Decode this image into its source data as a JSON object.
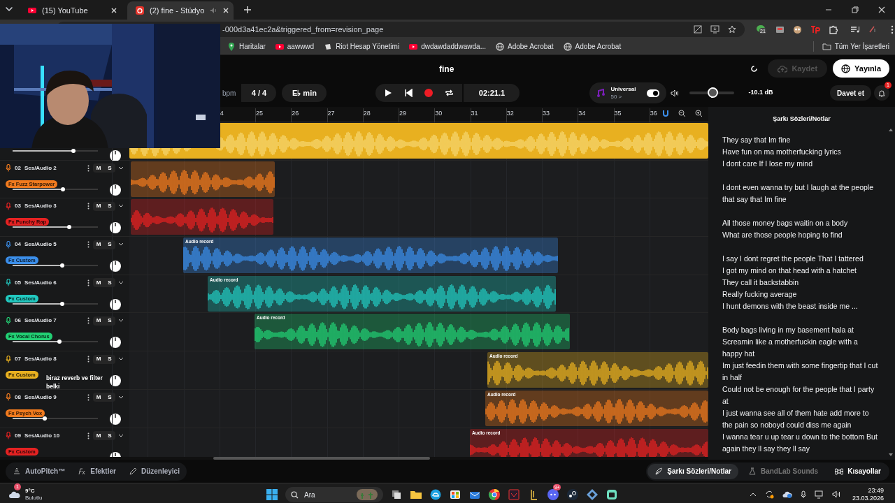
{
  "browser": {
    "tabs": [
      {
        "label": "(15) YouTube",
        "selected": false
      },
      {
        "label": "(2) fine - Stüdyo",
        "selected": true
      }
    ],
    "url": "-000d3a41ec2a&triggered_from=revision_page",
    "extension_badge": "21",
    "bookmarks": [
      "Haritalar",
      "aawwwd",
      "Riot Hesap Yönetimi",
      "dwdawdaddwawda...",
      "Adobe Acrobat",
      "Adobe Acrobat"
    ],
    "all_bookmarks": "Tüm Yer İşaretleri"
  },
  "project": {
    "title": "fine",
    "save": "Kaydet",
    "publish": "Yayınla"
  },
  "transport": {
    "bpm_label": "bpm",
    "time_signature": "4 / 4",
    "key": "E♭ min",
    "time": "02:21.1",
    "universal": {
      "label": "Universal",
      "value": "50 >",
      "on": true
    },
    "volume": {
      "level": 0.51,
      "reading": "-10.1 dB"
    },
    "invite": "Davet et",
    "notifications": "1"
  },
  "ruler": [
    "4",
    "25",
    "26",
    "27",
    "28",
    "29",
    "30",
    "31",
    "32",
    "33",
    "34",
    "35",
    "36"
  ],
  "tracks": [
    {
      "color": "#e8b020",
      "level": 0.71
    },
    {
      "number": "02",
      "name": "Ses/Audio 2",
      "fx": "Fx Fuzz Starpower",
      "color": "#f07a1e",
      "level": 0.59,
      "mute": "M",
      "solo": "S"
    },
    {
      "number": "03",
      "name": "Ses/Audio 3",
      "fx": "Fx Punchy Rap",
      "color": "#e52222",
      "level": 0.66,
      "mute": "M",
      "solo": "S"
    },
    {
      "number": "04",
      "name": "Ses/Audio 5",
      "fx": "Fx Custom",
      "color": "#3b8eea",
      "level": 0.58,
      "mute": "M",
      "solo": "S",
      "clip_label": "Audio record"
    },
    {
      "number": "05",
      "name": "Ses/Audio 6",
      "fx": "Fx Custom",
      "color": "#22c9c0",
      "level": 0.58,
      "mute": "M",
      "solo": "S",
      "clip_label": "Audio record"
    },
    {
      "number": "06",
      "name": "Ses/Audio 7",
      "fx": "Fx Vocal Chorus",
      "color": "#22d074",
      "level": 0.55,
      "mute": "M",
      "solo": "S",
      "clip_label": "Audio record"
    },
    {
      "number": "07",
      "name": "Ses/Audio 8",
      "fx": "Fx Custom",
      "color": "#e8b020",
      "note": "biraz reverb ve filter belki",
      "mute": "M",
      "solo": "S",
      "clip_label": "Audio record"
    },
    {
      "number": "08",
      "name": "Ses/Audio 9",
      "fx": "Fx Psych Vox",
      "color": "#f07a1e",
      "level": 0.38,
      "mute": "M",
      "solo": "S",
      "clip_label": "Audio record"
    },
    {
      "number": "09",
      "name": "Ses/Audio 10",
      "fx": "Fx Custom",
      "color": "#e52222",
      "mute": "M",
      "solo": "S",
      "clip_label": "Audio record"
    }
  ],
  "lyrics": {
    "title": "Şarkı Sözleri/Notlar",
    "stanzas": [
      [
        "They say that Im fine",
        "Have fun on ma motherfucking lyrics",
        "I dont care If I lose my mind"
      ],
      [
        "I dont even wanna try but I laugh at the people that say that Im fine"
      ],
      [
        "All those money bags waitin on a body",
        "What are those people hoping to find"
      ],
      [
        "I say I dont regret the people That I tattered",
        "I got my mind on that head with a hatchet",
        "They call it backstabbin",
        "Really fucking average",
        "I hunt demons with the beast inside me ..."
      ],
      [
        "Body bags living in my basement hala at",
        "Screamin like a motherfuckin eagle with a happy hat",
        "Im just feedin them with some fingertip that I cut in half",
        "Could not be enough for the people that I party at",
        "I just wanna see all of them hate add more to the pain so noboyd could diss me again",
        "I wanna tear u up tear u down to the bottom But again they ll say they ll say"
      ]
    ]
  },
  "bottom_left": [
    {
      "kind": "pitch",
      "label": "AutoPitch™"
    },
    {
      "kind": "fx",
      "label": "Efektler"
    },
    {
      "kind": "pencil",
      "label": "Düzenleyici"
    }
  ],
  "bottom_right": [
    {
      "kind": "feather",
      "label": "Şarkı Sözleri/Notlar",
      "selected": true,
      "disabled": false
    },
    {
      "kind": "flask",
      "label": "BandLab Sounds",
      "selected": false,
      "disabled": true
    },
    {
      "kind": "command",
      "label": "Kısayollar",
      "selected": false,
      "disabled": false
    }
  ],
  "taskbar": {
    "weather": {
      "temp": "9°C",
      "desc": "Bulutlu",
      "badge": "1"
    },
    "search": "Ara",
    "discord_badge": "9+",
    "time": "23:49",
    "date": "23.03.2026"
  }
}
